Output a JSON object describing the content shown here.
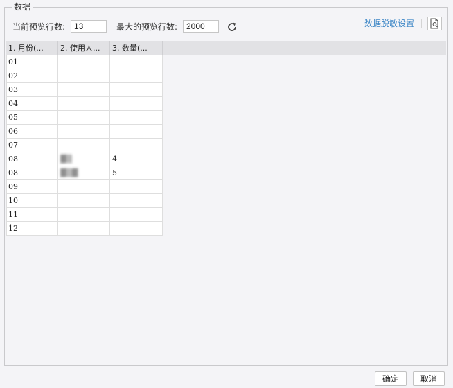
{
  "dialog": {
    "section_title": "数据",
    "current_preview_label": "当前预览行数:",
    "current_preview_value": "13",
    "max_preview_label": "最大的预览行数:",
    "max_preview_value": "2000",
    "desensitize_link": "数据脱敏设置",
    "refresh_icon": "refresh-icon",
    "preview_icon": "document-search-icon"
  },
  "table": {
    "columns": [
      "1. 月份(...",
      "2. 使用人...",
      "3. 数量(..."
    ],
    "rows": [
      [
        "01",
        "",
        ""
      ],
      [
        "02",
        "",
        ""
      ],
      [
        "03",
        "",
        ""
      ],
      [
        "04",
        "",
        ""
      ],
      [
        "05",
        "",
        ""
      ],
      [
        "06",
        "",
        ""
      ],
      [
        "07",
        "",
        ""
      ],
      [
        "08",
        "",
        "4"
      ],
      [
        "08",
        "",
        "5"
      ],
      [
        "09",
        "",
        ""
      ],
      [
        "10",
        "",
        ""
      ],
      [
        "11",
        "",
        ""
      ],
      [
        "12",
        "",
        ""
      ]
    ]
  },
  "footer": {
    "ok_label": "确定",
    "cancel_label": "取消"
  }
}
